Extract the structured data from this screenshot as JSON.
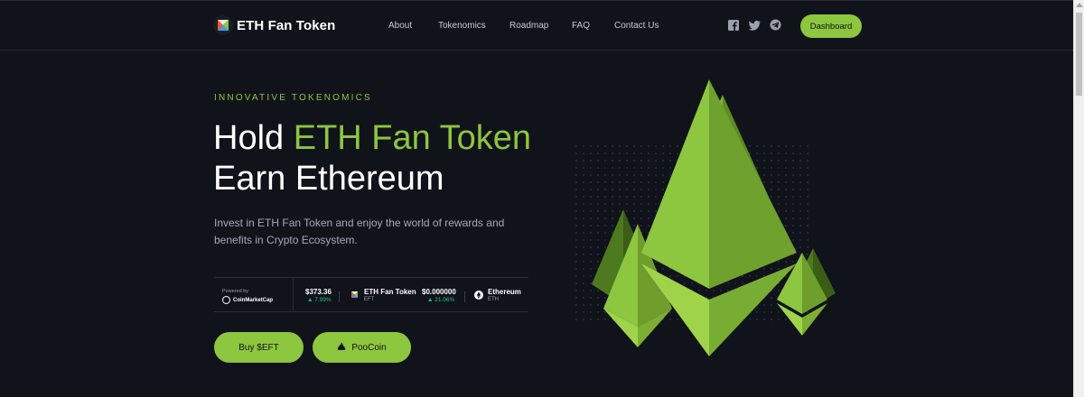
{
  "brand": {
    "name": "ETH Fan Token"
  },
  "nav": {
    "items": [
      {
        "label": "About",
        "name": "nav-about"
      },
      {
        "label": "Tokenomics",
        "name": "nav-tokenomics"
      },
      {
        "label": "Roadmap",
        "name": "nav-roadmap"
      },
      {
        "label": "FAQ",
        "name": "nav-faq"
      },
      {
        "label": "Contact Us",
        "name": "nav-contact-us"
      }
    ],
    "social_icons": [
      "facebook-icon",
      "twitter-icon",
      "telegram-icon"
    ],
    "dashboard_label": "Dashboard"
  },
  "hero": {
    "eyebrow": "INNOVATIVE TOKENOMICS",
    "title_prefix": "Hold ",
    "title_accent": "ETH Fan Token",
    "title_line2": "Earn Ethereum",
    "description": "Invest in ETH Fan Token and enjoy the world of rewards and benefits in Crypto Ecosystem."
  },
  "ticker": {
    "powered_by": "Powered by",
    "provider": "CoinMarketCap",
    "items": [
      {
        "price": "$373.36",
        "change": "7.99%",
        "name": "ETH Fan Token",
        "symbol": "EFT"
      },
      {
        "price": "$0.000000",
        "change": "21.06%",
        "name": "Ethereum",
        "symbol": "ETH"
      }
    ]
  },
  "buttons": {
    "buy_label": "Buy $EFT",
    "poocoin_label": "PooCoin"
  },
  "colors": {
    "background": "#11131b",
    "accent": "#8dc63f",
    "positive": "#16c784",
    "text_muted": "#a4aab8"
  }
}
